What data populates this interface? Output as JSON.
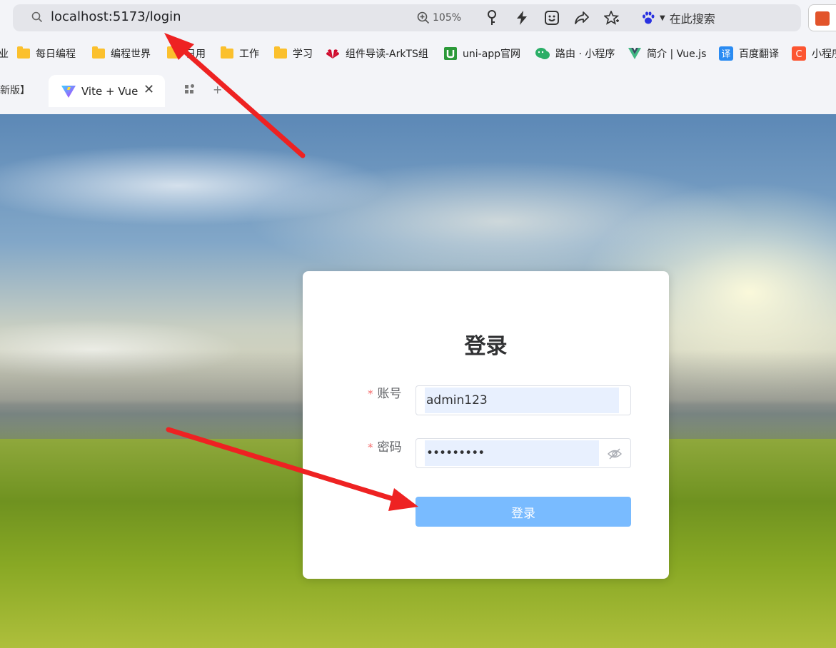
{
  "browser": {
    "url": "localhost:5173/login",
    "zoom": "105%",
    "search_engine_label": "在此搜索"
  },
  "bookmarks": [
    {
      "label": "业",
      "icon": "folder-icon"
    },
    {
      "label": "每日编程",
      "icon": "folder-icon"
    },
    {
      "label": "编程世界",
      "icon": "folder-icon"
    },
    {
      "label": "日用",
      "icon": "folder-icon"
    },
    {
      "label": "工作",
      "icon": "folder-icon"
    },
    {
      "label": "学习",
      "icon": "folder-icon"
    },
    {
      "label": "组件导读-ArkTS组",
      "icon": "huawei-icon"
    },
    {
      "label": "uni-app官网",
      "icon": "uniapp-icon"
    },
    {
      "label": "路由 · 小程序",
      "icon": "wechat-icon"
    },
    {
      "label": "简介 | Vue.js",
      "icon": "vue-icon"
    },
    {
      "label": "百度翻译",
      "icon": "translate-icon"
    },
    {
      "label": "小程序",
      "icon": "csdn-icon"
    }
  ],
  "tabs": {
    "previous_label": "新版】",
    "active_label": "Vite + Vue"
  },
  "login": {
    "title": "登录",
    "account_label": "账号",
    "account_value": "admin123",
    "password_label": "密码",
    "password_value": "•••••••••",
    "required_mark": "*",
    "submit_label": "登录"
  },
  "colors": {
    "primary_light": "#79bbff",
    "required": "#f56c6c",
    "autofill": "#e8f0fe",
    "annotation_arrow": "#ee2222"
  }
}
